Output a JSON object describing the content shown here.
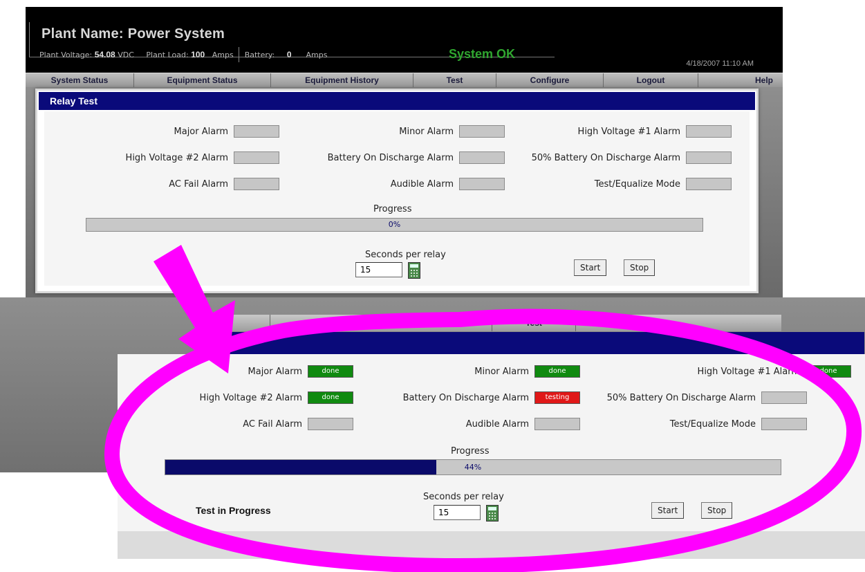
{
  "header": {
    "title": "Plant Name: Power System",
    "plant_voltage_label": "Plant Voltage:",
    "plant_voltage_value": "54.08",
    "plant_voltage_unit": "VDC",
    "plant_load_label": "Plant Load:",
    "plant_load_value": "100",
    "plant_load_unit": "Amps",
    "battery_label": "Battery:",
    "battery_value": "0",
    "battery_unit": "Amps",
    "status": "System OK",
    "datetime": "4/18/2007 11:10 AM"
  },
  "nav": {
    "items": [
      "System Status",
      "Equipment Status",
      "Equipment History",
      "Test",
      "Configure",
      "Logout",
      "Help"
    ]
  },
  "zoom_nav": {
    "items": [
      "Equipment History",
      "Test"
    ]
  },
  "relay_test": {
    "title": "Relay Test",
    "alarms": [
      "Major Alarm",
      "Minor Alarm",
      "High Voltage #1 Alarm",
      "High Voltage #2 Alarm",
      "Battery On Discharge Alarm",
      "50% Battery On Discharge Alarm",
      "AC Fail Alarm",
      "Audible Alarm",
      "Test/Equalize Mode"
    ],
    "progress_label": "Progress",
    "progress_percent": 0,
    "progress_text": "0%",
    "seconds_label": "Seconds per relay",
    "seconds_value": "15",
    "start_label": "Start",
    "stop_label": "Stop"
  },
  "relay_test_zoom": {
    "states": [
      {
        "status": "done",
        "color": "#108a10"
      },
      {
        "status": "done",
        "color": "#108a10"
      },
      {
        "status": "done",
        "color": "#108a10"
      },
      {
        "status": "done",
        "color": "#108a10"
      },
      {
        "status": "testing",
        "color": "#e01818"
      },
      {
        "status": "",
        "color": "#c6c6c6"
      },
      {
        "status": "",
        "color": "#c6c6c6"
      },
      {
        "status": "",
        "color": "#c6c6c6"
      },
      {
        "status": "",
        "color": "#c6c6c6"
      }
    ],
    "progress_percent": 44,
    "progress_text": "44%",
    "status_text": "Test in Progress",
    "seconds_value": "15"
  },
  "annotation": {
    "highlight_color": "#ff00ff"
  }
}
